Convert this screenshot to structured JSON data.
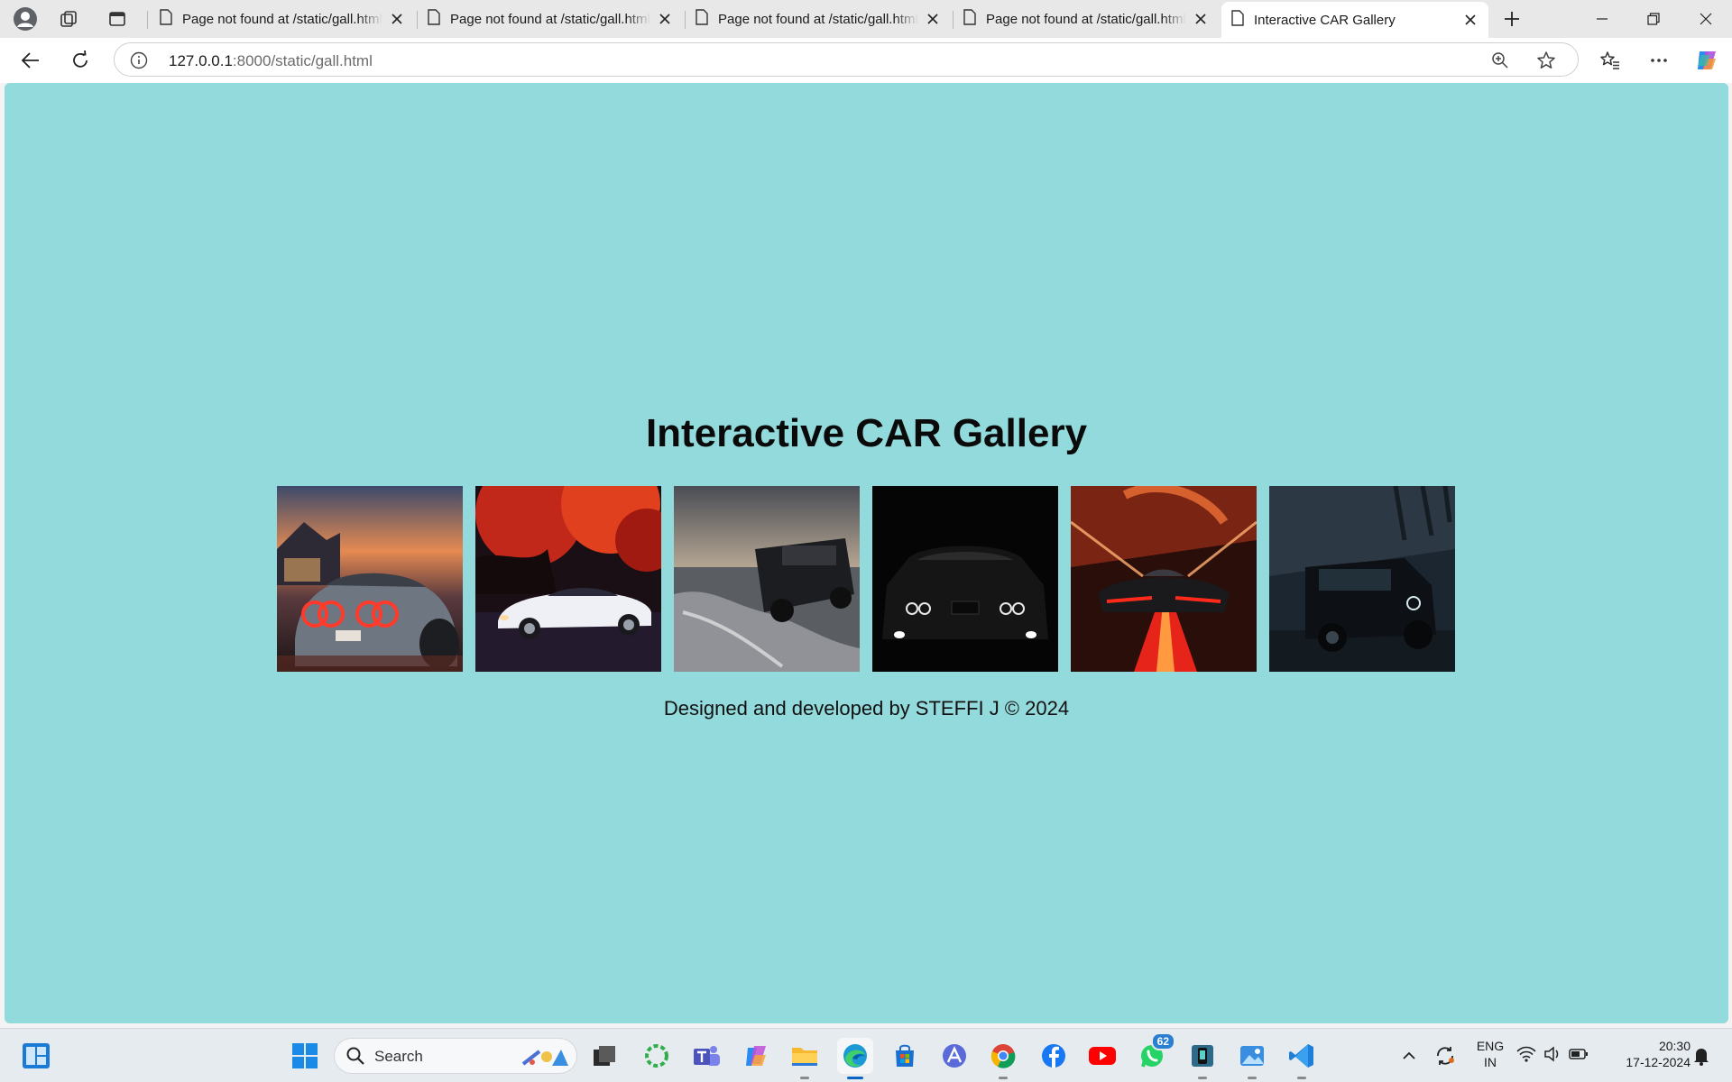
{
  "browser": {
    "tabs": [
      {
        "label": "Page not found at /static/gall.html",
        "active": false
      },
      {
        "label": "Page not found at /static/gall.html",
        "active": false
      },
      {
        "label": "Page not found at /static/gall.html",
        "active": false
      },
      {
        "label": "Page not found at /static/gall.html",
        "active": false
      },
      {
        "label": "Interactive CAR Gallery",
        "active": true
      }
    ],
    "address": {
      "host": "127.0.0.1",
      "rest": ":8000/static/gall.html"
    }
  },
  "page": {
    "title": "Interactive CAR Gallery",
    "gallery": [
      {
        "icon": "car-photo-rear-red-taillights"
      },
      {
        "icon": "car-photo-white-sports-coupe"
      },
      {
        "icon": "car-photo-suv-on-water"
      },
      {
        "icon": "car-photo-dark-front-headlights"
      },
      {
        "icon": "car-photo-red-black-supercar"
      },
      {
        "icon": "car-photo-dark-suv"
      }
    ],
    "footer": "Designed and developed by STEFFI J © 2024"
  },
  "colors": {
    "page_background": "#93dadc",
    "taskbar": "#e6ebf0",
    "accent": "#0a64c8"
  },
  "taskbar": {
    "search_placeholder": "Search",
    "whatsapp_badge": "62",
    "language": {
      "line1": "ENG",
      "line2": "IN"
    },
    "clock": {
      "time": "20:30",
      "date": "17-12-2024"
    }
  }
}
